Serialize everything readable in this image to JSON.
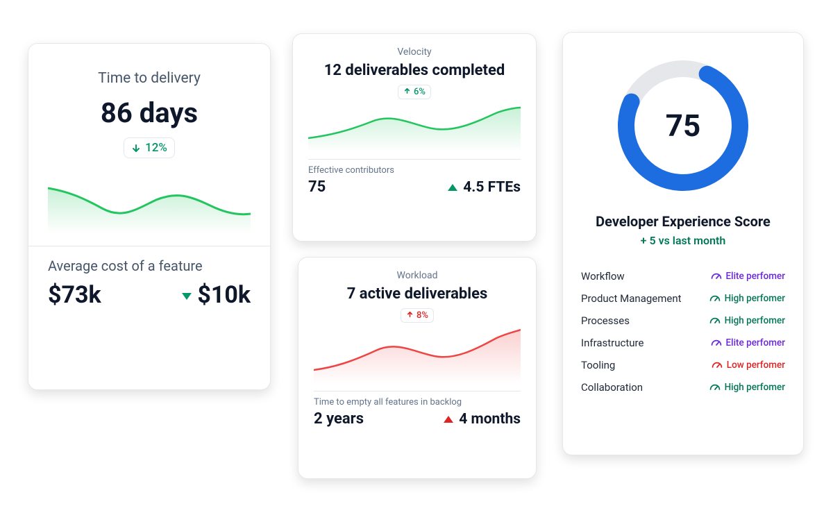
{
  "delivery": {
    "title": "Time to delivery",
    "value": "86 days",
    "change_arrow": "down",
    "change_text": "12%",
    "change_positive": true,
    "sub_title": "Average cost of a feature",
    "sub_value": "$73k",
    "sub_delta_direction": "down",
    "sub_delta": "$10k"
  },
  "velocity": {
    "label": "Velocity",
    "headline": "12 deliverables completed",
    "change_arrow": "up",
    "change_text": "6%",
    "sub_label": "Effective contributors",
    "sub_value": "75",
    "sub_delta_direction": "up",
    "sub_delta": "4.5 FTEs"
  },
  "workload": {
    "label": "Workload",
    "headline": "7 active deliverables",
    "change_arrow": "up",
    "change_text": "8%",
    "sub_label": "Time to empty all features in backlog",
    "sub_value": "2 years",
    "sub_delta_direction": "up",
    "sub_delta": "4 months"
  },
  "dx": {
    "score": "75",
    "donut_percent": 75,
    "title": "Developer Experience Score",
    "delta": "+ 5 vs last month",
    "categories": [
      {
        "name": "Workflow",
        "tier": "elite",
        "label": "Elite perfomer"
      },
      {
        "name": "Product Management",
        "tier": "high",
        "label": "High perfomer"
      },
      {
        "name": "Processes",
        "tier": "high",
        "label": "High perfomer"
      },
      {
        "name": "Infrastructure",
        "tier": "elite",
        "label": "Elite perfomer"
      },
      {
        "name": "Tooling",
        "tier": "low",
        "label": "Low perfomer"
      },
      {
        "name": "Collaboration",
        "tier": "high",
        "label": "High perfomer"
      }
    ]
  },
  "colors": {
    "green": "#22c55e",
    "green_dark": "#059669",
    "red": "#ef4444",
    "blue": "#1d6de0",
    "grey_ring": "#e5e7eb"
  },
  "chart_data": [
    {
      "id": "delivery_sparkline",
      "type": "area",
      "color": "#22c55e",
      "x": [
        0,
        1,
        2,
        3,
        4,
        5,
        6,
        7
      ],
      "values": [
        72,
        58,
        40,
        38,
        55,
        58,
        45,
        32
      ],
      "ylim": [
        0,
        100
      ]
    },
    {
      "id": "velocity_sparkline",
      "type": "area",
      "color": "#22c55e",
      "x": [
        0,
        1,
        2,
        3,
        4,
        5,
        6,
        7
      ],
      "values": [
        28,
        34,
        52,
        50,
        42,
        48,
        70,
        78
      ],
      "ylim": [
        0,
        100
      ]
    },
    {
      "id": "workload_sparkline",
      "type": "area",
      "color": "#ef4444",
      "x": [
        0,
        1,
        2,
        3,
        4,
        5,
        6,
        7
      ],
      "values": [
        26,
        32,
        50,
        48,
        40,
        46,
        68,
        80
      ],
      "ylim": [
        0,
        100
      ]
    },
    {
      "id": "dx_donut",
      "type": "pie",
      "title": "Developer Experience Score",
      "values": [
        75,
        25
      ],
      "categories": [
        "score",
        "remaining"
      ],
      "colors": [
        "#1d6de0",
        "#e5e7eb"
      ]
    }
  ]
}
